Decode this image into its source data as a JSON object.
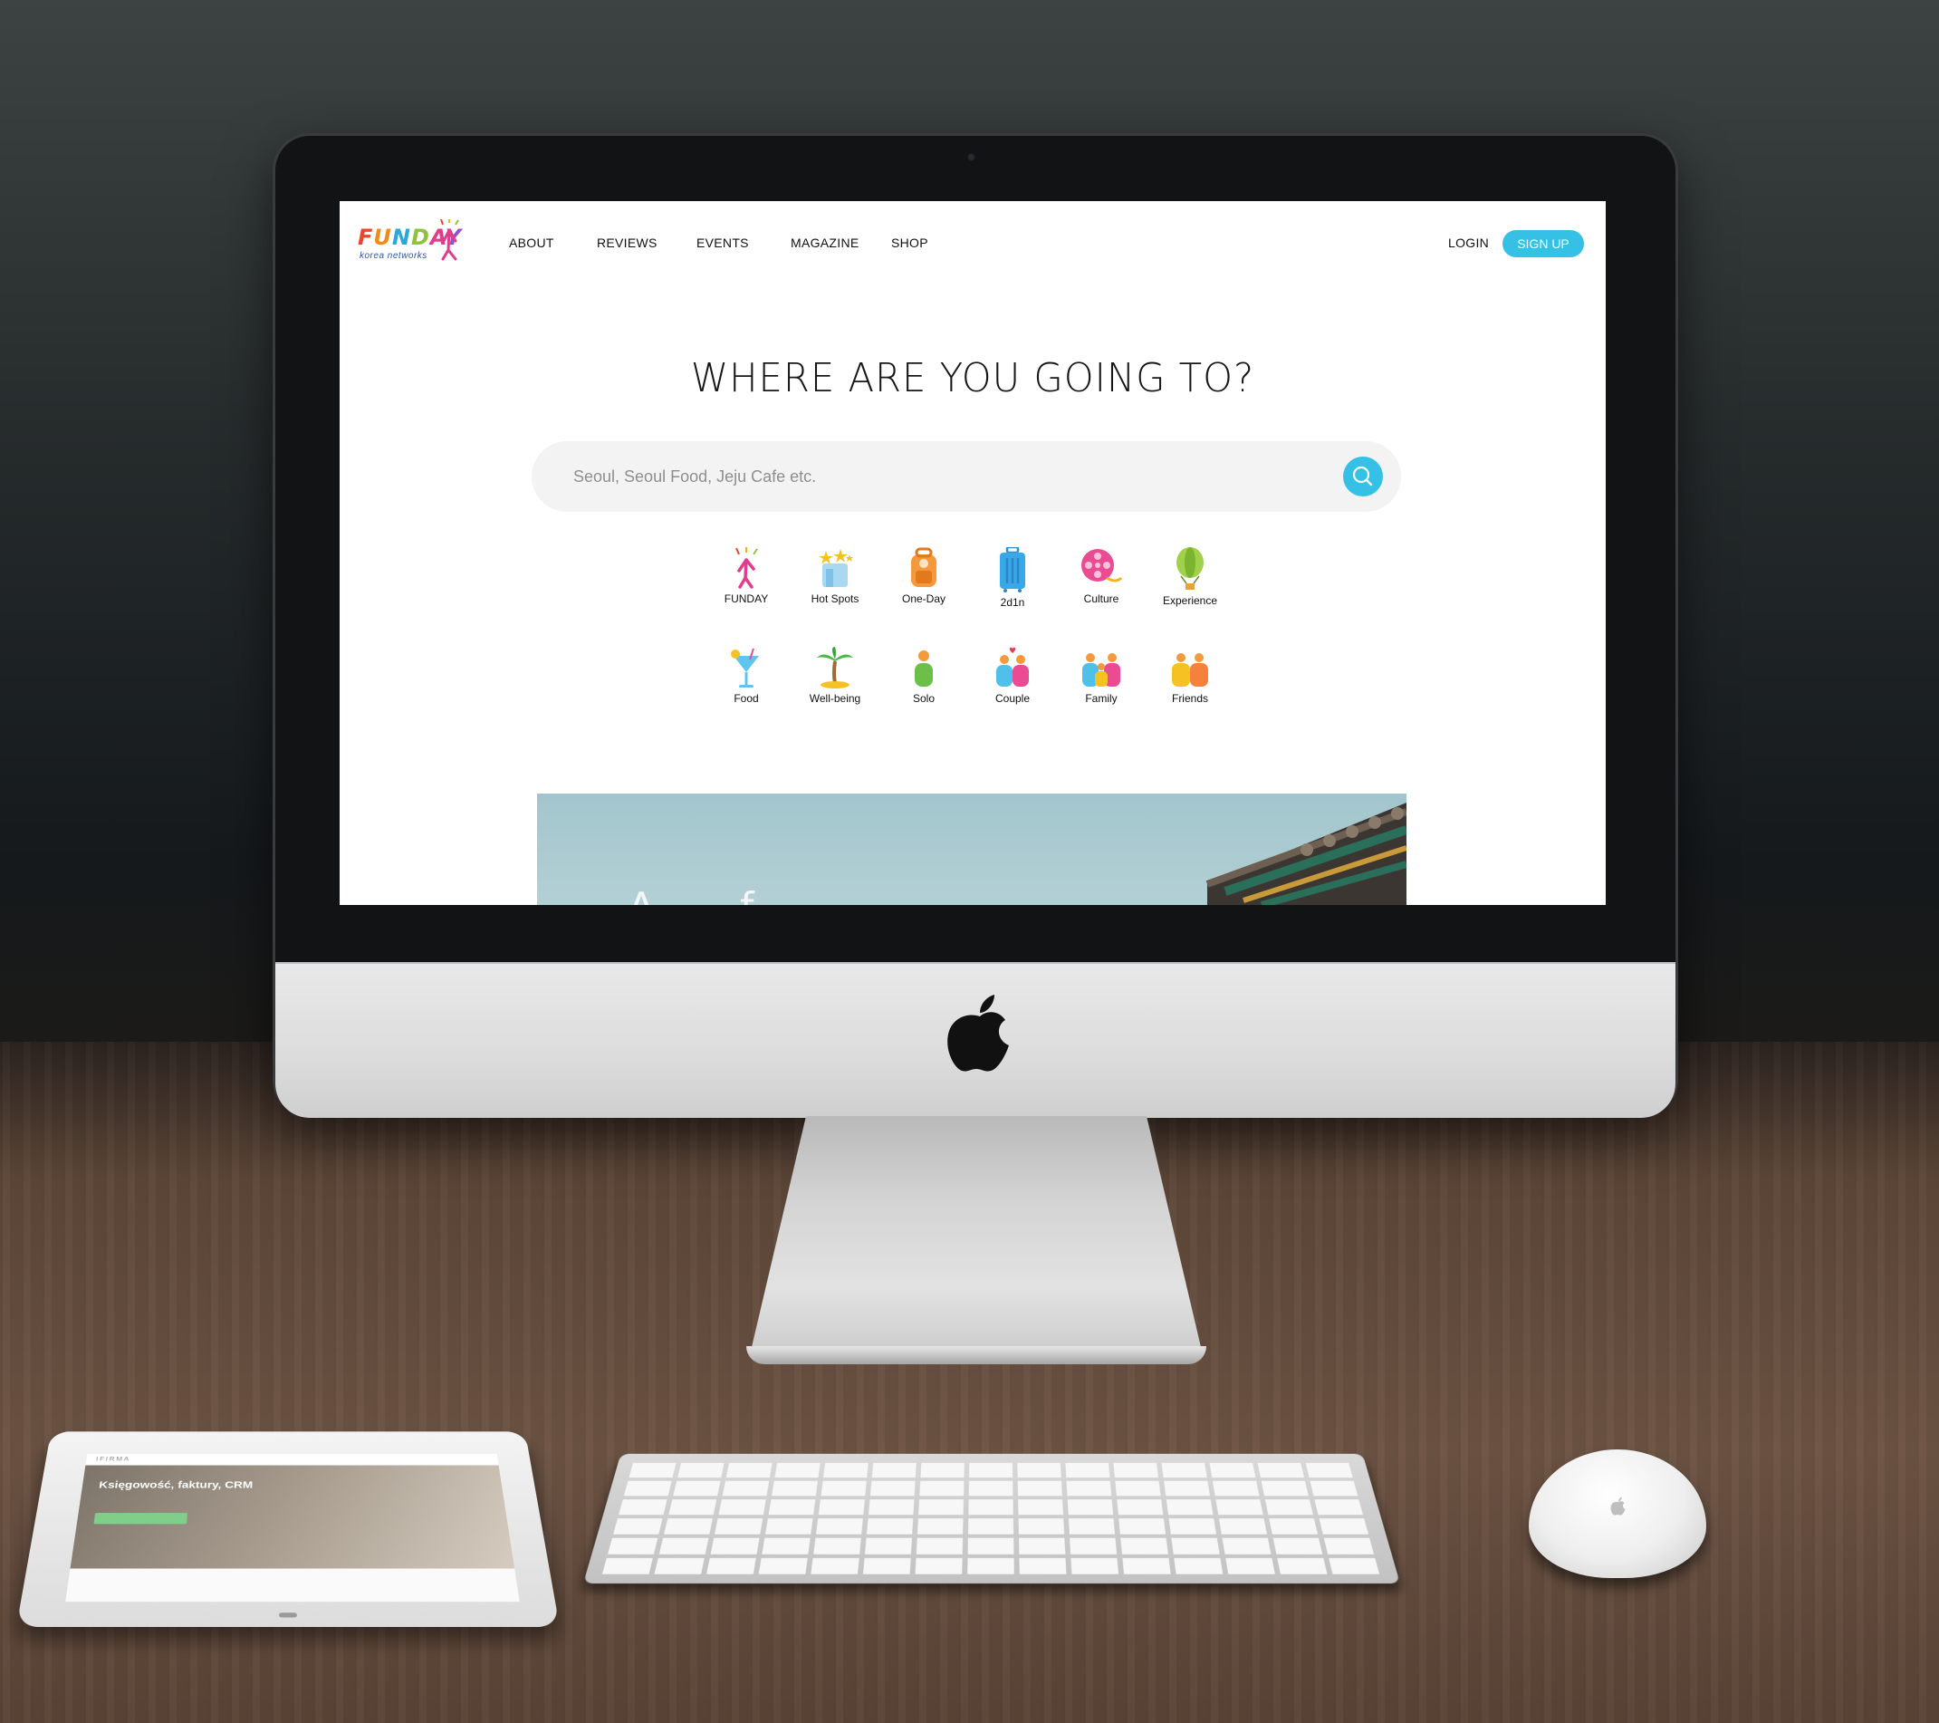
{
  "nav": {
    "logo_text": "FUNDAY",
    "logo_sub": "korea networks",
    "links": [
      "ABOUT",
      "REVIEWS",
      "EVENTS",
      "MAGAZINE",
      "SHOP"
    ],
    "login": "LOGIN",
    "signup": "SIGN UP"
  },
  "hero": {
    "title": "WHERE ARE YOU GOING TO?",
    "search_placeholder": "Seoul, Seoul Food, Jeju Cafe etc."
  },
  "categories": {
    "row1": [
      {
        "label": "FUNDAY",
        "icon": "funday-icon"
      },
      {
        "label": "Hot Spots",
        "icon": "hot-spots-icon"
      },
      {
        "label": "One-Day",
        "icon": "backpack-icon"
      },
      {
        "label": "2d1n",
        "icon": "luggage-icon"
      },
      {
        "label": "Culture",
        "icon": "film-reel-icon"
      },
      {
        "label": "Experience",
        "icon": "hot-air-balloon-icon"
      }
    ],
    "row2": [
      {
        "label": "Food",
        "icon": "cocktail-icon"
      },
      {
        "label": "Well-being",
        "icon": "palm-tree-icon"
      },
      {
        "label": "Solo",
        "icon": "person-icon"
      },
      {
        "label": "Couple",
        "icon": "couple-icon"
      },
      {
        "label": "Family",
        "icon": "family-icon"
      },
      {
        "label": "Friends",
        "icon": "friends-icon"
      }
    ]
  },
  "banner": {
    "text": "A ... f"
  },
  "tablet": {
    "headline": "Księgowość, faktury, CRM",
    "brand": "IFIRMA"
  },
  "colors": {
    "accent": "#35c1e6",
    "search_bg": "#f3f3f3"
  }
}
